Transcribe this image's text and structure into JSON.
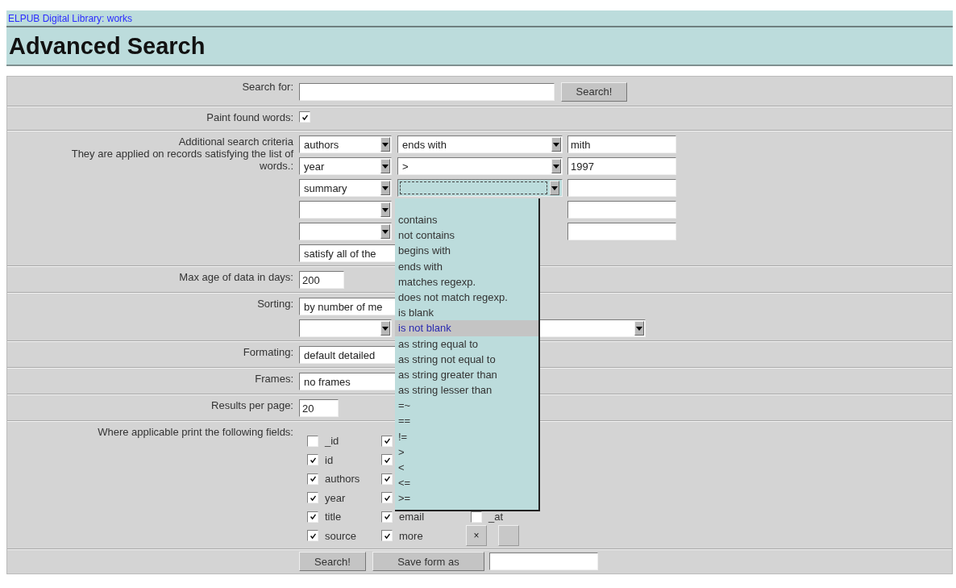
{
  "breadcrumb": "ELPUB Digital Library: works",
  "title": "Advanced Search",
  "search": {
    "label": "Search for:",
    "button": "Search!"
  },
  "paint_found_words": {
    "label": "Paint found words:",
    "checked": true
  },
  "criteria": {
    "label": "Additional search criteria",
    "note": "They are applied on records satisfying the list of words.:",
    "rows": [
      {
        "kind": "filled",
        "field": "authors",
        "operator": "ends with",
        "value": "mith"
      },
      {
        "kind": "filled",
        "field": "year",
        "operator": ">",
        "value": "1997"
      },
      {
        "kind": "focused",
        "field": "summary"
      },
      {
        "kind": "covered"
      },
      {
        "kind": "covered"
      }
    ],
    "combine": "satisfy all of the"
  },
  "operator_menu": {
    "options": [
      {
        "label": "contains",
        "selected": false
      },
      {
        "label": "not contains",
        "selected": false
      },
      {
        "label": "begins with",
        "selected": false
      },
      {
        "label": "ends with",
        "selected": false
      },
      {
        "label": "matches regexp.",
        "selected": false
      },
      {
        "label": "does not match regexp.",
        "selected": false
      },
      {
        "label": "is blank",
        "selected": false
      },
      {
        "label": "is not blank",
        "selected": true
      },
      {
        "label": "as string equal to",
        "selected": false
      },
      {
        "label": "as string not equal to",
        "selected": false
      },
      {
        "label": "as string greater than",
        "selected": false
      },
      {
        "label": "as string lesser than",
        "selected": false
      },
      {
        "label": "=~",
        "selected": false
      },
      {
        "label": "==",
        "selected": false
      },
      {
        "label": "!=",
        "selected": false
      },
      {
        "label": ">",
        "selected": false
      },
      {
        "label": "<",
        "selected": false
      },
      {
        "label": "<=",
        "selected": false
      },
      {
        "label": ">=",
        "selected": false
      }
    ]
  },
  "max_age": {
    "label": "Max age of data in days:",
    "value": "200"
  },
  "sorting": {
    "label": "Sorting:",
    "value": "by number of me"
  },
  "formatting": {
    "label": "Formating:",
    "value": "default detailed"
  },
  "frames": {
    "label": "Frames:",
    "value": "no frames"
  },
  "results_per_page": {
    "label": "Results per page:",
    "value": "20"
  },
  "print_fields": {
    "label": "Where applicable print the following fields:",
    "rows": [
      [
        {
          "label": "_id",
          "checked": false
        },
        {
          "checked": true
        }
      ],
      [
        {
          "label": "id",
          "checked": true
        },
        {
          "checked": true
        }
      ],
      [
        {
          "label": "authors",
          "checked": true
        },
        {
          "checked": true
        }
      ],
      [
        {
          "label": "year",
          "checked": true
        },
        {
          "checked": true
        }
      ],
      [
        {
          "label": "title",
          "checked": true
        },
        {
          "label": "email",
          "checked": true
        },
        {
          "label": "_at",
          "checked": false
        }
      ],
      [
        {
          "label": "source",
          "checked": true
        },
        {
          "label": "more",
          "checked": true
        }
      ]
    ],
    "small_buttons": [
      {
        "kind": "close",
        "label": "×"
      },
      {
        "kind": "blank"
      }
    ]
  },
  "footer": {
    "buttons": [
      "Search!",
      "Save form as"
    ]
  }
}
